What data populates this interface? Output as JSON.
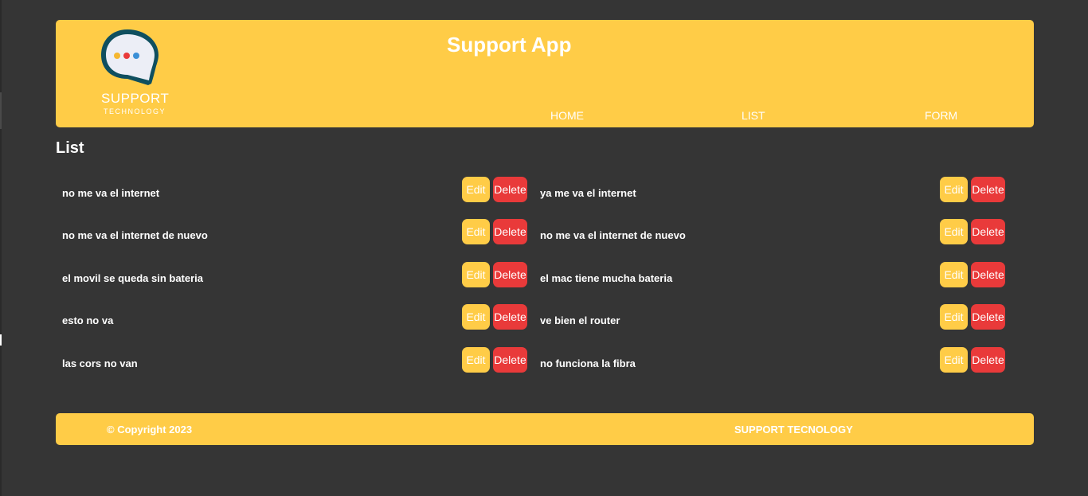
{
  "header": {
    "title": "Support App",
    "logo": {
      "primary": "SUPPORT",
      "secondary": "TECHNOLOGY",
      "icon": "chat-bubble-icon"
    },
    "nav": {
      "home": "HOME",
      "list": "LIST",
      "form": "FORM"
    }
  },
  "main": {
    "heading": "List",
    "edit_label": "Edit",
    "delete_label": "Delete",
    "tickets_left": [
      "no me va el internet",
      "no me va el internet de nuevo",
      "el movil se queda sin bateria",
      "esto no va",
      "las cors no van"
    ],
    "tickets_right": [
      "ya me va el internet",
      "no me va el internet de nuevo",
      "el mac tiene mucha bateria",
      "ve bien el router",
      "no funciona la fibra"
    ]
  },
  "footer": {
    "copyright": "© Copyright 2023",
    "brand": "SUPPORT TECNOLOGY"
  },
  "colors": {
    "background": "#353535",
    "accent": "#ffcc47",
    "danger": "#e93a3a",
    "text": "#ffffff"
  }
}
